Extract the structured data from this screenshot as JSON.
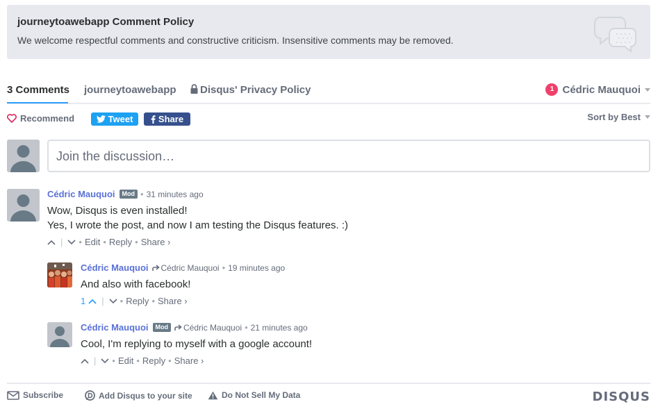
{
  "policy": {
    "title": "journeytoawebapp Comment Policy",
    "text": "We welcome respectful comments and constructive criticism. Insensitive comments may be removed.",
    "icon": "speech-bubbles-icon"
  },
  "nav": {
    "comments_tab": "3 Comments",
    "site_tab": "journeytoawebapp",
    "privacy_tab": "Disqus' Privacy Policy",
    "notification_count": "1",
    "user_name": "Cédric Mauquoi"
  },
  "actions": {
    "recommend": "Recommend",
    "tweet": "Tweet",
    "share": "Share",
    "sort": "Sort by Best"
  },
  "composer": {
    "placeholder": "Join the discussion…"
  },
  "comments": [
    {
      "author": "Cédric Mauquoi",
      "badge": "Mod",
      "time": "31 minutes ago",
      "body": [
        "Wow, Disqus is even installed!",
        "Yes, I wrote the post, and now I am testing the Disqus features. :)"
      ],
      "actions": [
        "Edit",
        "Reply",
        "Share ›"
      ]
    },
    {
      "author": "Cédric Mauquoi",
      "reply_to": "Cédric Mauquoi",
      "time": "19 minutes ago",
      "body": [
        "And also with facebook!"
      ],
      "upvotes": "1",
      "actions": [
        "Reply",
        "Share ›"
      ]
    },
    {
      "author": "Cédric Mauquoi",
      "badge": "Mod",
      "reply_to": "Cédric Mauquoi",
      "time": "21 minutes ago",
      "body": [
        "Cool, I'm replying to myself with a google account!"
      ],
      "actions": [
        "Edit",
        "Reply",
        "Share ›"
      ]
    }
  ],
  "footer": {
    "subscribe": "Subscribe",
    "add_disqus": "Add Disqus to your site",
    "do_not_sell": "Do Not Sell My Data",
    "logo": "DISQUS"
  },
  "colors": {
    "accent_blue": "#2e9fff",
    "author_link": "#5a71d6",
    "twitter": "#1da1f2",
    "facebook": "#35508c",
    "notification": "#f0406a",
    "recommend_heart": "#e0245e"
  }
}
